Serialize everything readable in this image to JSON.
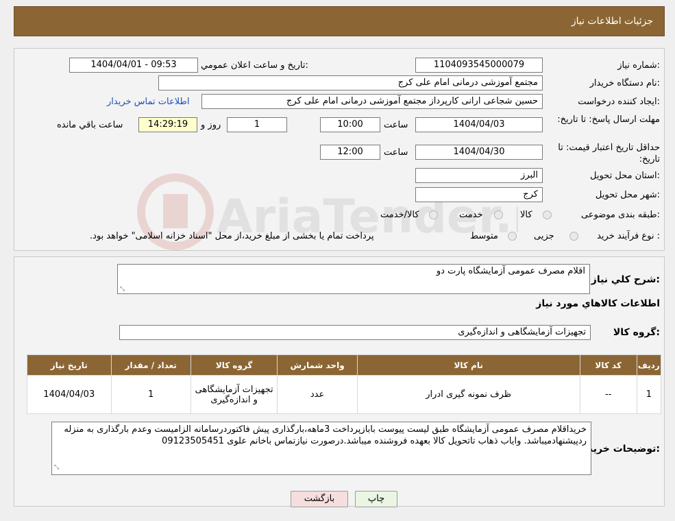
{
  "header": {
    "title": "جزئیات اطلاعات نیاز"
  },
  "details": {
    "need_number_label": "شماره نیاز:",
    "need_number": "1104093545000079",
    "announce_label": "تاريخ و ساعت اعلان عمومي:",
    "announce_value": "1404/04/01 - 09:53",
    "buyer_org_label": "نام دستگاه خريدار:",
    "buyer_org": "مجتمع آموزشی درمانی امام علی کرج",
    "creator_label": "ايجاد کننده درخواست:",
    "creator": "حسین شجاعی ارانی کارپرداز مجتمع آموزشی درمانی امام علی کرج",
    "contact_link": "اطلاعات تماس خريدار",
    "deadline_label": "مهلت ارسال پاسخ: تا تاريخ:",
    "deadline_date": "1404/04/03",
    "time_label": "ساعت",
    "deadline_time": "10:00",
    "days_remaining": "1",
    "day_and_label": "روز و",
    "time_remaining": "14:29:19",
    "remaining_label": "ساعت باقي مانده",
    "validity_label": "حداقل تاريخ اعتبار قيمت: تا تاريخ:",
    "validity_date": "1404/04/30",
    "validity_time_label": "ساعت",
    "validity_time": "12:00",
    "province_label": "استان محل تحويل:",
    "province": "البرز",
    "city_label": "شهر محل تحويل:",
    "city": "کرج",
    "category_label": "طبقه بندی موضوعی:",
    "category_options": [
      "کالا",
      "خدمت",
      "کالا/خدمت"
    ],
    "process_label": "نوع فرآيند خريد :",
    "process_options": [
      "جزیی",
      "متوسط"
    ],
    "process_note": "پرداخت تمام يا بخشی از مبلغ خريد،از محل \"اسناد خزانه اسلامی\" خواهد بود."
  },
  "summary": {
    "description_label": "شرح کلي نياز:",
    "description": "اقلام مصرف عمومی آزمایشگاه پارت دو",
    "goods_info_title": "اطلاعات کالاهاي مورد نياز",
    "goods_group_label": "گروه کالا:",
    "goods_group": "تجهیزات آزمایشگاهی و اندازه‌گیری"
  },
  "table": {
    "headers": [
      "رديف",
      "کد کالا",
      "نام کالا",
      "واحد شمارش",
      "گروه کالا",
      "تعداد / مقدار",
      "تاريخ نياز"
    ],
    "rows": [
      [
        "1",
        "--",
        "ظرف نمونه گیری ادرار",
        "عدد",
        "تجهیزات آزمایشگاهی و اندازه‌گیری",
        "1",
        "1404/04/03"
      ]
    ]
  },
  "buyer_notes": {
    "label": "توضيحات خريدار:",
    "text": "خریداقلام مصرف عمومی آزمایشگاه طبق لیست پیوست بابازپرداخت 3ماهه،بارگذاری پیش فاکتوردرسامانه الزامیست وعدم بارگذاری به منزله ردپیشنهادمیباشد. وایاب ذهاب تاتحویل کالا بعهده فروشنده میباشد.درصورت نیازتماس باخانم علوی 09123505451"
  },
  "buttons": {
    "print": "چاپ",
    "back": "بازگشت"
  },
  "watermark_text": "AriaTender.neT",
  "colors": {
    "header_brown": "#8b6634",
    "link_blue": "#1f4fc0",
    "back_button_pink": "#f7dede",
    "print_button_green": "#eaf6e3"
  }
}
